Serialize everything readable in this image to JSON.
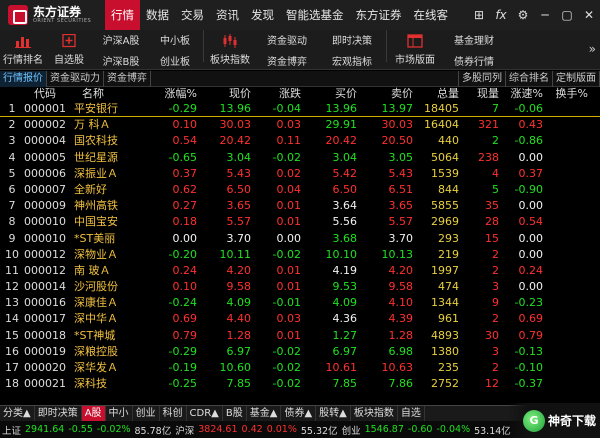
{
  "app": {
    "logo_cn": "东方证券",
    "logo_en": "ORIENT SECURITIES"
  },
  "menus": [
    "行情",
    "数据",
    "交易",
    "资讯",
    "发现",
    "智能选基金",
    "东方证券",
    "在线客"
  ],
  "window_controls": [
    "⊞",
    "fx",
    "⚙",
    "─",
    "▢",
    "✕"
  ],
  "toolbar": {
    "big1": {
      "label": "行情排名",
      "icon": "bar-chart-icon"
    },
    "big2": {
      "label": "自选股",
      "icon": "plus-square-icon"
    },
    "stack1": [
      "沪深A股",
      "沪深B股"
    ],
    "stack2": [
      "中小板",
      "创业板"
    ],
    "big3": {
      "label": "板块指数",
      "icon": "candles-icon"
    },
    "stack3": [
      "资金驱动",
      "资金博弈"
    ],
    "stack4": [
      "即时决策",
      "宏观指标"
    ],
    "big4": {
      "label": "市场版面",
      "icon": "layout-icon"
    },
    "stack5": [
      "基金理财",
      "债券行情"
    ],
    "expand": "»"
  },
  "subtabs": [
    "行情报价",
    "资金驱动力",
    "资金博弈"
  ],
  "subtabs_right": [
    "多股同列",
    "综合排名",
    "定制版面"
  ],
  "table": {
    "headers": {
      "idx": "",
      "code": "代码",
      "name": "名称",
      "pct": "涨幅%",
      "price": "现价",
      "chg": "涨跌",
      "buy": "买价",
      "sell": "卖价",
      "vol": "总量",
      "cur": "现量",
      "spd": "涨速%",
      "turn": "换手%"
    },
    "rows": [
      {
        "idx": "1",
        "code": "000001",
        "name": "平安银行",
        "pct": "-0.29",
        "price": "13.96",
        "chg": "-0.04",
        "buy": "13.96",
        "sell": "13.97",
        "vol": "18405",
        "cur": "7",
        "spd": "-0.06",
        "turn": "",
        "c": [
          "green",
          "green",
          "green",
          "green",
          "green",
          "yellow",
          "green",
          "green"
        ]
      },
      {
        "idx": "2",
        "code": "000002",
        "name": "万 科Ａ",
        "pct": "0.10",
        "price": "30.03",
        "chg": "0.03",
        "buy": "29.91",
        "sell": "30.03",
        "vol": "16404",
        "cur": "321",
        "spd": "0.43",
        "turn": "",
        "c": [
          "red",
          "red",
          "red",
          "green",
          "red",
          "yellow",
          "red",
          "red"
        ]
      },
      {
        "idx": "3",
        "code": "000004",
        "name": "国农科技",
        "pct": "0.54",
        "price": "20.42",
        "chg": "0.11",
        "buy": "20.42",
        "sell": "20.50",
        "vol": "440",
        "cur": "2",
        "spd": "-0.86",
        "turn": "",
        "c": [
          "red",
          "red",
          "red",
          "red",
          "red",
          "yellow",
          "green",
          "green"
        ]
      },
      {
        "idx": "4",
        "code": "000005",
        "name": "世纪星源",
        "pct": "-0.65",
        "price": "3.04",
        "chg": "-0.02",
        "buy": "3.04",
        "sell": "3.05",
        "vol": "5064",
        "cur": "238",
        "spd": "0.00",
        "turn": "",
        "c": [
          "green",
          "green",
          "green",
          "green",
          "green",
          "yellow",
          "red",
          "white"
        ]
      },
      {
        "idx": "5",
        "code": "000006",
        "name": "深振业Ａ",
        "pct": "0.37",
        "price": "5.43",
        "chg": "0.02",
        "buy": "5.42",
        "sell": "5.43",
        "vol": "1539",
        "cur": "4",
        "spd": "0.37",
        "turn": "",
        "c": [
          "red",
          "red",
          "red",
          "red",
          "red",
          "yellow",
          "red",
          "red"
        ]
      },
      {
        "idx": "6",
        "code": "000007",
        "name": "全新好",
        "pct": "0.62",
        "price": "6.50",
        "chg": "0.04",
        "buy": "6.50",
        "sell": "6.51",
        "vol": "844",
        "cur": "5",
        "spd": "-0.90",
        "turn": "",
        "c": [
          "red",
          "red",
          "red",
          "red",
          "red",
          "yellow",
          "green",
          "green"
        ]
      },
      {
        "idx": "7",
        "code": "000009",
        "name": "神州高铁",
        "pct": "0.27",
        "price": "3.65",
        "chg": "0.01",
        "buy": "3.64",
        "sell": "3.65",
        "vol": "5855",
        "cur": "35",
        "spd": "0.00",
        "turn": "",
        "c": [
          "red",
          "red",
          "red",
          "white",
          "red",
          "yellow",
          "red",
          "white"
        ]
      },
      {
        "idx": "8",
        "code": "000010",
        "name": "中国宝安",
        "pct": "0.18",
        "price": "5.57",
        "chg": "0.01",
        "buy": "5.56",
        "sell": "5.57",
        "vol": "2969",
        "cur": "28",
        "spd": "0.54",
        "turn": "",
        "c": [
          "red",
          "red",
          "red",
          "white",
          "red",
          "yellow",
          "red",
          "red"
        ]
      },
      {
        "idx": "9",
        "code": "000010",
        "name": "*ST美丽",
        "pct": "0.00",
        "price": "3.70",
        "chg": "0.00",
        "buy": "3.68",
        "sell": "3.70",
        "vol": "293",
        "cur": "15",
        "spd": "0.00",
        "turn": "",
        "c": [
          "white",
          "white",
          "white",
          "green",
          "white",
          "yellow",
          "red",
          "white"
        ]
      },
      {
        "idx": "10",
        "code": "000012",
        "name": "深物业Ａ",
        "pct": "-0.20",
        "price": "10.11",
        "chg": "-0.02",
        "buy": "10.10",
        "sell": "10.13",
        "vol": "219",
        "cur": "2",
        "spd": "0.00",
        "turn": "",
        "c": [
          "green",
          "green",
          "green",
          "green",
          "green",
          "yellow",
          "red",
          "white"
        ]
      },
      {
        "idx": "11",
        "code": "000012",
        "name": "南 玻Ａ",
        "pct": "0.24",
        "price": "4.20",
        "chg": "0.01",
        "buy": "4.19",
        "sell": "4.20",
        "vol": "1997",
        "cur": "2",
        "spd": "0.24",
        "turn": "",
        "c": [
          "red",
          "red",
          "red",
          "white",
          "red",
          "yellow",
          "red",
          "red"
        ]
      },
      {
        "idx": "12",
        "code": "000014",
        "name": "沙河股份",
        "pct": "0.10",
        "price": "9.58",
        "chg": "0.01",
        "buy": "9.53",
        "sell": "9.58",
        "vol": "474",
        "cur": "3",
        "spd": "0.00",
        "turn": "",
        "c": [
          "red",
          "red",
          "red",
          "green",
          "red",
          "yellow",
          "red",
          "white"
        ]
      },
      {
        "idx": "13",
        "code": "000016",
        "name": "深康佳Ａ",
        "pct": "-0.24",
        "price": "4.09",
        "chg": "-0.01",
        "buy": "4.09",
        "sell": "4.10",
        "vol": "1344",
        "cur": "9",
        "spd": "-0.23",
        "turn": "",
        "c": [
          "green",
          "green",
          "green",
          "green",
          "red",
          "yellow",
          "red",
          "green"
        ]
      },
      {
        "idx": "14",
        "code": "000017",
        "name": "深中华Ａ",
        "pct": "0.69",
        "price": "4.40",
        "chg": "0.03",
        "buy": "4.36",
        "sell": "4.39",
        "vol": "961",
        "cur": "2",
        "spd": "0.69",
        "turn": "",
        "c": [
          "red",
          "red",
          "red",
          "white",
          "red",
          "yellow",
          "red",
          "red"
        ]
      },
      {
        "idx": "15",
        "code": "000018",
        "name": "*ST神城",
        "pct": "0.79",
        "price": "1.28",
        "chg": "0.01",
        "buy": "1.27",
        "sell": "1.28",
        "vol": "4893",
        "cur": "30",
        "spd": "0.79",
        "turn": "",
        "c": [
          "red",
          "red",
          "red",
          "green",
          "red",
          "yellow",
          "red",
          "red"
        ]
      },
      {
        "idx": "16",
        "code": "000019",
        "name": "深粮控股",
        "pct": "-0.29",
        "price": "6.97",
        "chg": "-0.02",
        "buy": "6.97",
        "sell": "6.98",
        "vol": "1380",
        "cur": "3",
        "spd": "-0.13",
        "turn": "",
        "c": [
          "green",
          "green",
          "green",
          "green",
          "green",
          "yellow",
          "red",
          "green"
        ]
      },
      {
        "idx": "17",
        "code": "000020",
        "name": "深华发Ａ",
        "pct": "-0.19",
        "price": "10.60",
        "chg": "-0.02",
        "buy": "10.61",
        "sell": "10.63",
        "vol": "235",
        "cur": "2",
        "spd": "-0.10",
        "turn": "",
        "c": [
          "green",
          "green",
          "green",
          "red",
          "red",
          "yellow",
          "red",
          "green"
        ]
      },
      {
        "idx": "18",
        "code": "000021",
        "name": "深科技",
        "pct": "-0.25",
        "price": "7.85",
        "chg": "-0.02",
        "buy": "7.85",
        "sell": "7.86",
        "vol": "2752",
        "cur": "12",
        "spd": "-0.37",
        "turn": "",
        "c": [
          "green",
          "green",
          "green",
          "green",
          "green",
          "yellow",
          "red",
          "green"
        ]
      }
    ]
  },
  "bottom_tabs": [
    "分类▲",
    "即时决策",
    "A股",
    "中小",
    "创业",
    "科创",
    "CDR▲",
    "B股",
    "基金▲",
    "债券▲",
    "股转▲",
    "板块指数",
    "自选"
  ],
  "status": {
    "idx1_label": "上证",
    "idx1_val": "2941.64",
    "idx1_chg": "-0.55",
    "idx1_pct": "-0.02%",
    "idx1_amt": "85.78亿",
    "idx2_label": "沪深",
    "idx2_val": "3824.61",
    "idx2_chg": "0.42",
    "idx2_pct": "0.01%",
    "idx2_amt": "55.32亿",
    "idx3_label": "创业",
    "idx3_val": "1546.87",
    "idx3_chg": "-0.60",
    "idx3_pct": "-0.04%",
    "idx3_amt": "53.14亿"
  },
  "watermark": {
    "badge": "G",
    "text": "神奇下载"
  }
}
